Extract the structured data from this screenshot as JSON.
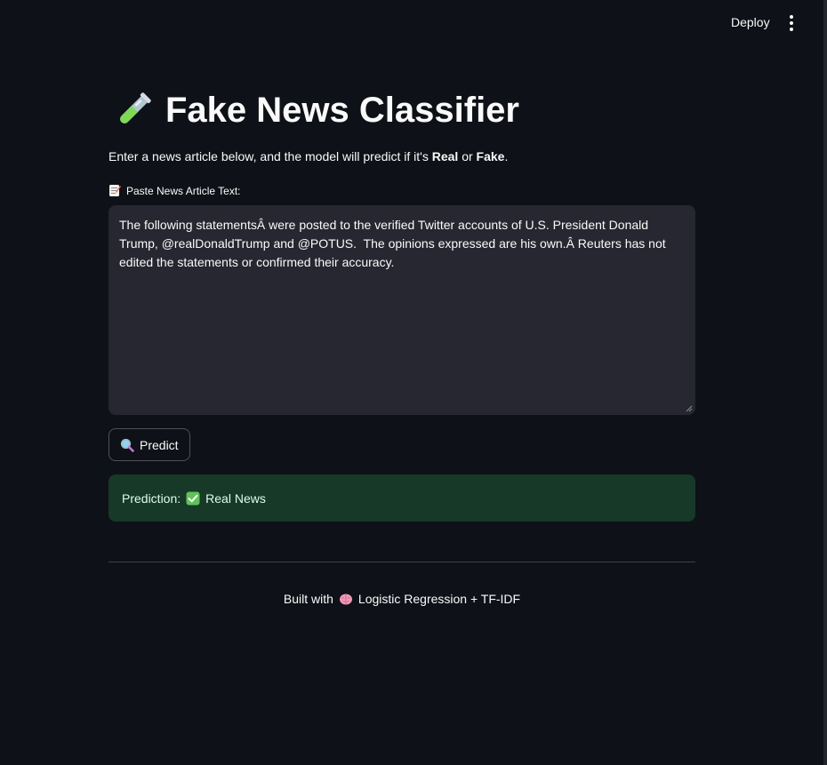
{
  "header": {
    "deploy_label": "Deploy",
    "menu_icon": "more-vertical-icon"
  },
  "title": {
    "icon": "test-tube-icon",
    "text": "Fake News Classifier"
  },
  "intro": {
    "prefix": "Enter a news article below, and the model will predict if it's ",
    "real": "Real",
    "or": " or ",
    "fake": "Fake",
    "suffix": "."
  },
  "input": {
    "label_icon": "memo-icon",
    "label": "Paste News Article Text:",
    "value": "The following statementsÂ were posted to the verified Twitter accounts of U.S. President Donald Trump, @realDonaldTrump and @POTUS.  The opinions expressed are his own.Â Reuters has not edited the statements or confirmed their accuracy."
  },
  "predict_button": {
    "icon": "magnifying-glass-icon",
    "label": "Predict"
  },
  "result": {
    "prefix": "Prediction:",
    "icon": "check-mark-icon",
    "label": "Real News"
  },
  "footer": {
    "prefix": "Built with",
    "icon": "brain-icon",
    "text": "Logistic Regression + TF-IDF"
  },
  "colors": {
    "background": "#0e1117",
    "textarea_bg": "#262730",
    "success_bg": "#173928",
    "success_text": "#dffde9"
  }
}
